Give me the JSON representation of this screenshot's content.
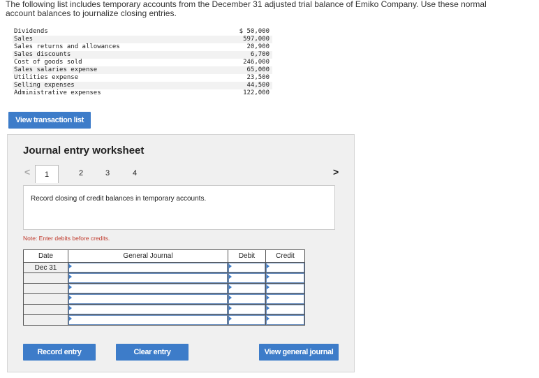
{
  "intro_text": "The following list includes temporary accounts from the December 31 adjusted trial balance of Emiko Company. Use these normal account balances to journalize closing entries.",
  "balances": [
    {
      "account": "Dividends",
      "amount": "$ 50,000"
    },
    {
      "account": "Sales",
      "amount": "597,000"
    },
    {
      "account": "Sales returns and allowances",
      "amount": "20,900"
    },
    {
      "account": "Sales discounts",
      "amount": "6,700"
    },
    {
      "account": "Cost of goods sold",
      "amount": "246,000"
    },
    {
      "account": "Sales salaries expense",
      "amount": "65,000"
    },
    {
      "account": "Utilities expense",
      "amount": "23,500"
    },
    {
      "account": "Selling expenses",
      "amount": "44,500"
    },
    {
      "account": "Administrative expenses",
      "amount": "122,000"
    }
  ],
  "view_transactions_label": "View transaction list",
  "worksheet": {
    "title": "Journal entry worksheet",
    "prev_arrow": "<",
    "next_arrow": ">",
    "tabs": [
      "1",
      "2",
      "3",
      "4"
    ],
    "active_tab": "1",
    "prompt": "Record closing of credit balances in temporary accounts.",
    "note": "Note: Enter debits before credits.",
    "columns": {
      "date": "Date",
      "account": "General Journal",
      "debit": "Debit",
      "credit": "Credit"
    },
    "rows": [
      {
        "date": "Dec 31"
      },
      {
        "date": ""
      },
      {
        "date": ""
      },
      {
        "date": ""
      },
      {
        "date": ""
      },
      {
        "date": ""
      }
    ],
    "record_label": "Record entry",
    "clear_label": "Clear entry",
    "view_journal_label": "View general journal"
  },
  "colors": {
    "accent": "#3d7cc9",
    "note": "#c0392b"
  }
}
